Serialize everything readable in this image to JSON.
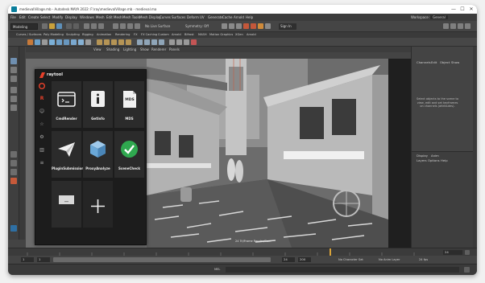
{
  "window": {
    "title": "medievalVillage.mb - Autodesk MAYA 2022: F:\\ray\\medievalVillage.mb - medieval.ma",
    "min": "—",
    "max": "☐",
    "close": "✕"
  },
  "menubar": {
    "items": [
      "File",
      "Edit",
      "Create",
      "Select",
      "Modify",
      "Display",
      "Windows",
      "Mesh",
      "Edit Mesh",
      "Mesh Tools",
      "Mesh Display",
      "Curves",
      "Surfaces",
      "Deform",
      "UV",
      "Generate",
      "Cache",
      "Arnold",
      "Help"
    ],
    "workspace_label": "Workspace :",
    "workspace_value": "General"
  },
  "statusline": {
    "mode": "Modeling",
    "surface_label": "No Live Surface",
    "symmetry_label": "Symmetry: Off",
    "signin": "Sign In"
  },
  "shelf": {
    "tabs": [
      "Curves / Surfaces",
      "Poly Modeling",
      "Sculpting",
      "Rigging",
      "Animation",
      "Rendering",
      "FX",
      "FX Caching",
      "Custom",
      "Arnold",
      "Bifrost",
      "MASH",
      "Motion Graphics",
      "XGen",
      "Arnold"
    ]
  },
  "viewport": {
    "menu": [
      "View",
      "Shading",
      "Lighting",
      "Show",
      "Renderer",
      "Panels"
    ],
    "label": "persp",
    "bottom_label": "24 Tri/Frame  Render/Cam"
  },
  "rightpanel": {
    "tabs": [
      "Channels",
      "Edit",
      "Object",
      "Show"
    ],
    "message": "Select objects to the scene to view, edit and set keyframes on channels (attributes).",
    "lower_tabs": [
      "Display",
      "Anim"
    ],
    "lower_subtabs": [
      "Layers",
      "Options",
      "Help"
    ]
  },
  "raytool": {
    "brand": "raytool",
    "tiles": [
      {
        "label": "CmdRender",
        "icon": "cmd-window-icon"
      },
      {
        "label": "GetInfo",
        "icon": "info-icon"
      },
      {
        "label": "MDS",
        "icon": "document-icon",
        "badge": "MDS"
      },
      {
        "label": "PluginSubmission",
        "icon": "paper-plane-icon"
      },
      {
        "label": "ProxyAnalyze",
        "icon": "cube-icon"
      },
      {
        "label": "SceneCheck",
        "icon": "check-circle-icon"
      },
      {
        "label": "",
        "icon": "screen-icon"
      },
      {
        "label": "",
        "icon": "plus-icon"
      }
    ],
    "side_icons": [
      "logo-icon",
      "r-icon",
      "person-icon",
      "star-icon",
      "gear-icon",
      "chart-icon",
      "menu-icon"
    ]
  },
  "timeline": {
    "start": "1",
    "end": "120",
    "range_start": "1",
    "range_end": "24",
    "current": "24",
    "max": "200",
    "char_set": "No Character Set",
    "anim_layer": "No Anim Layer",
    "fps": "24 fps"
  },
  "cmdline": {
    "label": "MEL"
  },
  "colors": {
    "accent": "#e8402a",
    "check_green": "#2fa84f",
    "cube_blue": "#6aa8d8"
  }
}
